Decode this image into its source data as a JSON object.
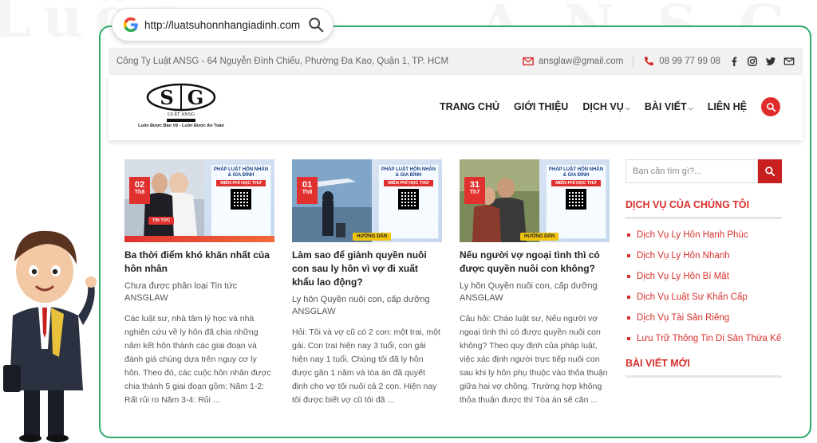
{
  "browser": {
    "url": "http://luatsuhonnhangiadinh.com"
  },
  "topbar": {
    "address": "Công Ty Luật ANSG - 64 Nguyễn Đình Chiểu, Phường Đa Kao, Quận 1, TP. HCM",
    "email": "ansglaw@gmail.com",
    "phone": "08 99 77 99 08",
    "icons": [
      "mail-icon",
      "phone-icon",
      "facebook-icon",
      "instagram-icon",
      "twitter-icon",
      "envelope-icon"
    ]
  },
  "logo": {
    "letters": "SG",
    "brand": "LUẬT ANSG",
    "tagline": "Luôn Được Bảo Vệ - Luôn Được An Toàn"
  },
  "nav": {
    "items": [
      {
        "label": "TRANG CHỦ"
      },
      {
        "label": "GIỚI THIỆU"
      },
      {
        "label": "DỊCH VỤ"
      },
      {
        "label": "BÀI VIẾT"
      },
      {
        "label": "LIÊN HỆ"
      }
    ]
  },
  "posts": [
    {
      "day": "02",
      "month": "Th8",
      "tag": "TIN TỨC",
      "title": "Ba thời điểm khó khăn nhất của hôn nhân",
      "category": "Chưa được phân loại Tin tức",
      "author": "ANSGLAW",
      "excerpt": "Các luật sư, nhà tâm lý học và nhà nghiên cứu về ly hôn đã chia những năm kết hôn thành các giai đoạn và đánh giá chúng dựa trên nguy cơ ly hôn. Theo đó, các cuộc hôn nhân được chia thành 5 giai đoạn gồm: Năm 1-2: Rất rủi ro Năm 3-4: Rủi ..."
    },
    {
      "day": "01",
      "month": "Th8",
      "tag": "HƯỚNG DẪN",
      "title": "Làm sao để giành quyền nuôi con sau ly hôn vì vợ đi xuất khẩu lao động?",
      "category": "Ly hôn Quyền nuôi con, cấp dưỡng",
      "author": "ANSGLAW",
      "excerpt": "Hỏi: Tôi và vợ cũ có 2 con: một trai, một gái. Con trai hiện nay 3 tuổi, con gái hiện nay 1 tuổi. Chúng tôi đã ly hôn được gần 1 năm và tòa án đã quyết định cho vợ tôi nuôi cả 2 con. Hiện nay tôi được biết vợ cũ tôi đã ..."
    },
    {
      "day": "31",
      "month": "Th7",
      "tag": "HƯỚNG DẪN",
      "title": "Nếu người vợ ngoại tình thì có được quyền nuôi con không?",
      "category": "Ly hôn Quyền nuôi con, cấp dưỡng",
      "author": "ANSGLAW",
      "excerpt": "Câu hỏi: Chào luật sư, Nếu người vợ ngoại tình thì có được quyền nuôi con không? Theo quy định của pháp luật, việc xác định người trực tiếp nuôi con sau khi ly hôn phụ thuộc vào thỏa thuận giữa hai vợ chồng. Trường hợp không thỏa thuận được thì Tòa án sẽ căn ..."
    }
  ],
  "ad": {
    "title": "PHÁP LUẬT HÔN NHÂN & GIA ĐÌNH",
    "cta": "MIỄN PHÍ HỌC THỬ"
  },
  "sidebar": {
    "search_placeholder": "Bạn cần tìm gì?...",
    "services_heading": "DỊCH VỤ CỦA CHÚNG TÔI",
    "services": [
      "Dịch Vụ Ly Hôn Hạnh Phúc",
      "Dịch Vụ Ly Hôn Nhanh",
      "Dịch Vụ Ly Hôn Bí Mật",
      "Dịch Vụ Luật Sư Khẩn Cấp",
      "Dịch Vụ Tài Sản Riêng",
      "Lưu Trữ Thông Tin Di Sản Thừa Kế"
    ],
    "recent_heading": "BÀI VIẾT MỚI"
  },
  "colors": {
    "accent_red": "#d6302c",
    "frame_green": "#2fa86a"
  }
}
